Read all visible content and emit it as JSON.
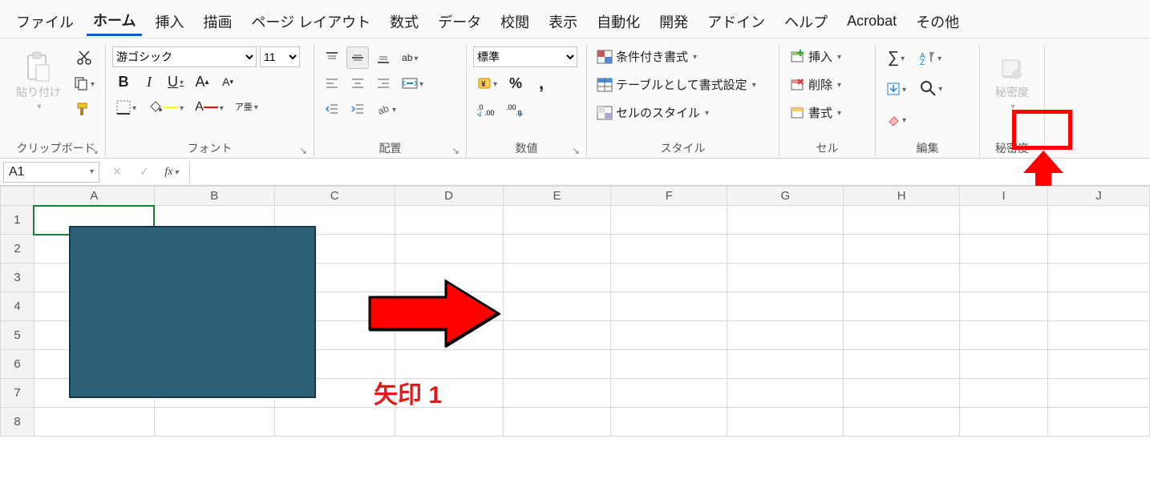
{
  "tabs": {
    "items": [
      "ファイル",
      "ホーム",
      "挿入",
      "描画",
      "ページ レイアウト",
      "数式",
      "データ",
      "校閲",
      "表示",
      "自動化",
      "開発",
      "アドイン",
      "ヘルプ",
      "Acrobat",
      "その他"
    ],
    "active_index": 1
  },
  "ribbon": {
    "clipboard": {
      "paste_label": "貼り付け",
      "group_label": "クリップボード"
    },
    "font": {
      "font_name": "游ゴシック",
      "font_size": "11",
      "ruby_label": "ア亜",
      "group_label": "フォント"
    },
    "alignment": {
      "wrap_label": "ab",
      "group_label": "配置"
    },
    "number": {
      "format": "標準",
      "group_label": "数値"
    },
    "styles": {
      "cond_label": "条件付き書式",
      "table_label": "テーブルとして書式設定",
      "cell_label": "セルのスタイル",
      "group_label": "スタイル"
    },
    "cells": {
      "insert_label": "挿入",
      "delete_label": "削除",
      "format_label": "書式",
      "group_label": "セル"
    },
    "editing": {
      "group_label": "編集"
    },
    "sensitivity": {
      "label": "秘密度",
      "group_label": "秘密度"
    }
  },
  "formula_bar": {
    "name_box": "A1",
    "formula": ""
  },
  "grid": {
    "columns": [
      "A",
      "B",
      "C",
      "D",
      "E",
      "F",
      "G",
      "H",
      "I",
      "J"
    ],
    "rows": [
      "1",
      "2",
      "3",
      "4",
      "5",
      "6",
      "7",
      "8"
    ],
    "selected_cell": "A1"
  },
  "annotations": {
    "arrow_label": "矢印 1"
  }
}
